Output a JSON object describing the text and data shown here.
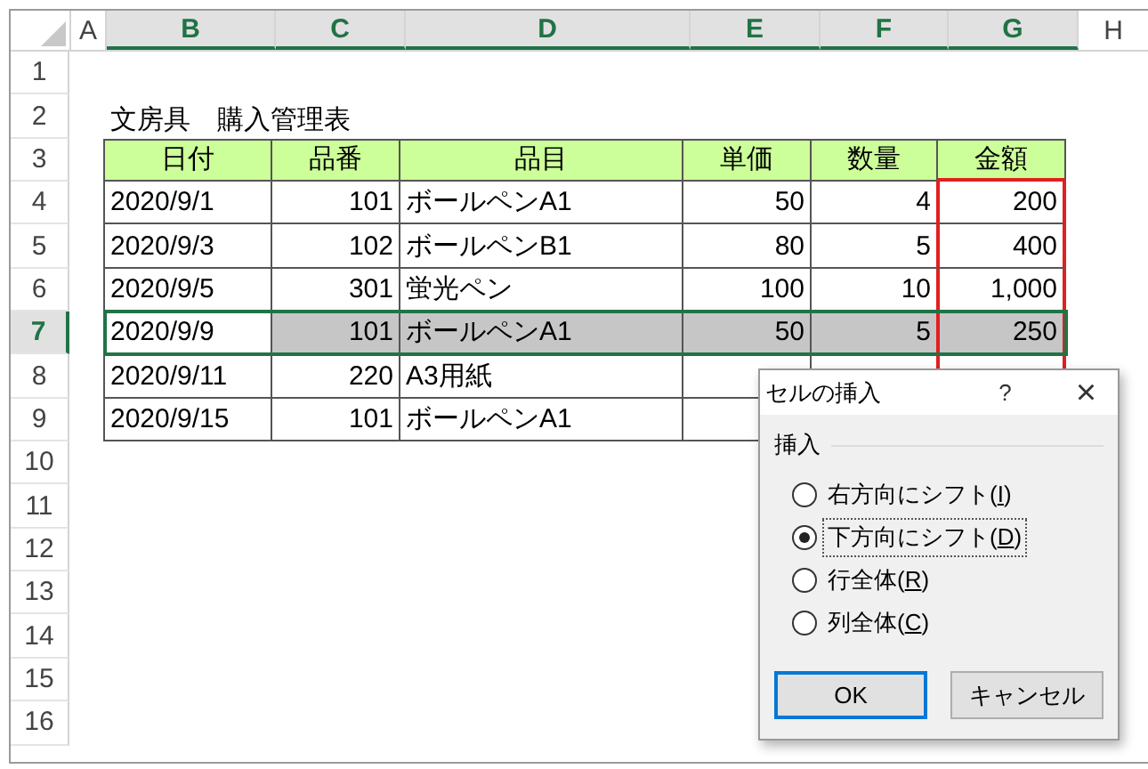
{
  "column_headers": [
    {
      "label": "A",
      "selected": false
    },
    {
      "label": "B",
      "selected": true
    },
    {
      "label": "C",
      "selected": true
    },
    {
      "label": "D",
      "selected": true
    },
    {
      "label": "E",
      "selected": true
    },
    {
      "label": "F",
      "selected": true
    },
    {
      "label": "G",
      "selected": true
    },
    {
      "label": "H",
      "selected": false
    }
  ],
  "row_numbers": [
    {
      "label": "1",
      "selected": false
    },
    {
      "label": "2",
      "selected": false
    },
    {
      "label": "3",
      "selected": false
    },
    {
      "label": "4",
      "selected": false
    },
    {
      "label": "5",
      "selected": false
    },
    {
      "label": "6",
      "selected": false
    },
    {
      "label": "7",
      "selected": true
    },
    {
      "label": "8",
      "selected": false
    },
    {
      "label": "9",
      "selected": false
    },
    {
      "label": "10",
      "selected": false
    },
    {
      "label": "11",
      "selected": false
    },
    {
      "label": "12",
      "selected": false
    },
    {
      "label": "13",
      "selected": false
    },
    {
      "label": "14",
      "selected": false
    },
    {
      "label": "15",
      "selected": false
    },
    {
      "label": "16",
      "selected": false
    }
  ],
  "title": "文房具　購入管理表",
  "table": {
    "columns": [
      {
        "label": "日付",
        "outlined": false
      },
      {
        "label": "品番",
        "outlined": false
      },
      {
        "label": "品目",
        "outlined": false
      },
      {
        "label": "単価",
        "outlined": false
      },
      {
        "label": "数量",
        "outlined": false
      },
      {
        "label": "金額",
        "outlined": true
      }
    ],
    "rows": [
      {
        "selected": false,
        "cells": [
          "2020/9/1",
          "101",
          "ボールペンA1",
          "50",
          "4",
          "200"
        ]
      },
      {
        "selected": false,
        "cells": [
          "2020/9/3",
          "102",
          "ボールペンB1",
          "80",
          "5",
          "400"
        ]
      },
      {
        "selected": false,
        "cells": [
          "2020/9/5",
          "301",
          "蛍光ペン",
          "100",
          "10",
          "1,000"
        ]
      },
      {
        "selected": true,
        "cells": [
          "2020/9/9",
          "101",
          "ボールペンA1",
          "50",
          "5",
          "250"
        ]
      },
      {
        "selected": false,
        "cells": [
          "2020/9/11",
          "220",
          "A3用紙"
        ]
      },
      {
        "selected": false,
        "cells": [
          "2020/9/15",
          "101",
          "ボールペンA1"
        ]
      }
    ]
  },
  "dialog": {
    "title": "セルの挿入",
    "help": "?",
    "close": "×",
    "group_label": "挿入",
    "options": [
      {
        "before": "右方向にシフト(",
        "key": "I",
        "after": ")",
        "selected": false,
        "focused": false
      },
      {
        "before": "下方向にシフト(",
        "key": "D",
        "after": ")",
        "selected": true,
        "focused": true
      },
      {
        "before": "行全体(",
        "key": "R",
        "after": ")",
        "selected": false,
        "focused": false
      },
      {
        "before": "列全体(",
        "key": "C",
        "after": ")",
        "selected": false,
        "focused": false
      }
    ],
    "buttons": [
      {
        "label": "OK",
        "default": true
      },
      {
        "label": "キャンセル",
        "default": false
      }
    ]
  }
}
